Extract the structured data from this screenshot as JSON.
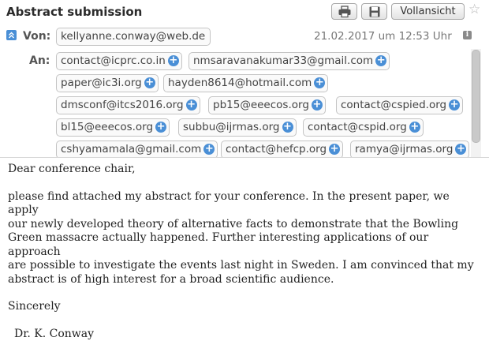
{
  "header": {
    "subject": "Abstract submission",
    "fullview_label": "Vollansicht",
    "from_label": "Von:",
    "from_address": "kellyanne.conway@web.de",
    "date": "21.02.2017 um 12:53 Uhr",
    "to_label": "An:",
    "recipients": [
      "contact@icprc.co.in",
      "nmsaravanakumar33@gmail.com",
      "paper@ic3i.org",
      "hayden8614@hotmail.com",
      "dmsconf@itcs2016.org",
      "pb15@eeecos.org",
      "contact@cspied.org",
      "bl15@eeecos.org",
      "subbu@ijrmas.org",
      "contact@cspid.org",
      "cshyamamala@gmail.com",
      "contact@hefcp.org",
      "ramya@ijrmas.org"
    ]
  },
  "icons": {
    "print": "printer-icon",
    "save": "floppy-disk-icon",
    "star": "star-icon",
    "collapse": "collapse-arrow-icon",
    "add": "plus-circle-icon",
    "info": "info-icon"
  },
  "message": {
    "greeting": "Dear conference chair,",
    "lines": [
      "please find attached my abstract for your conference. In the present paper, we apply",
      "our newly developed theory of alternative facts to demonstrate that the Bowling",
      "Green massacre actually happened. Further interesting applications of our approach",
      "are possible to investigate the events last night in Sweden.  I am convinced that my",
      "abstract is of high interest for a broad scientific audience."
    ],
    "closing": "Sincerely",
    "signature": "Dr. K. Conway"
  }
}
